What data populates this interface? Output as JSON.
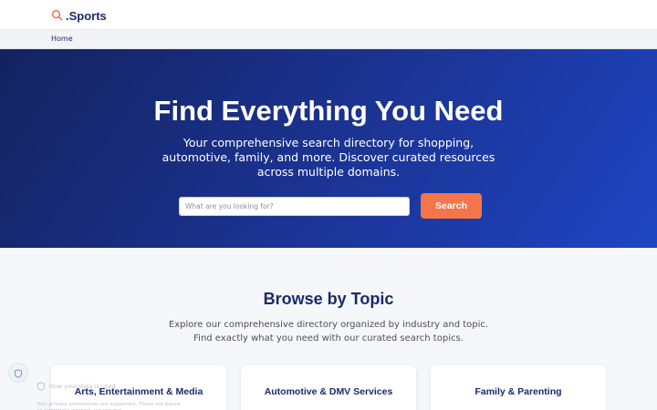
{
  "header": {
    "logo_text": ".Sports",
    "logo_icon": "search-icon"
  },
  "breadcrumb": {
    "home": "Home"
  },
  "hero": {
    "title": "Find Everything You Need",
    "subtitle": "Your comprehensive search directory for shopping, automotive, family, and more. Discover curated resources across multiple domains.",
    "search_placeholder": "What are you looking for?",
    "search_value": "",
    "search_button": "Search"
  },
  "browse": {
    "title": "Browse by Topic",
    "subtitle": "Explore our comprehensive directory organized by industry and topic. Find exactly what you need with our curated search topics.",
    "cards": [
      {
        "title": "Arts, Entertainment & Media"
      },
      {
        "title": "Automotive & DMV Services"
      },
      {
        "title": "Family & Parenting"
      }
    ]
  },
  "privacy": {
    "icon": "shield-icon",
    "title": "How your data is used",
    "body": "Your privacy preferences are supported. These are based on legitimate interest, we use our"
  },
  "colors": {
    "brand_navy": "#1b2a6b",
    "accent_orange": "#f5754b",
    "hero_gradient_start": "#14225e",
    "hero_gradient_end": "#1f45c3"
  }
}
